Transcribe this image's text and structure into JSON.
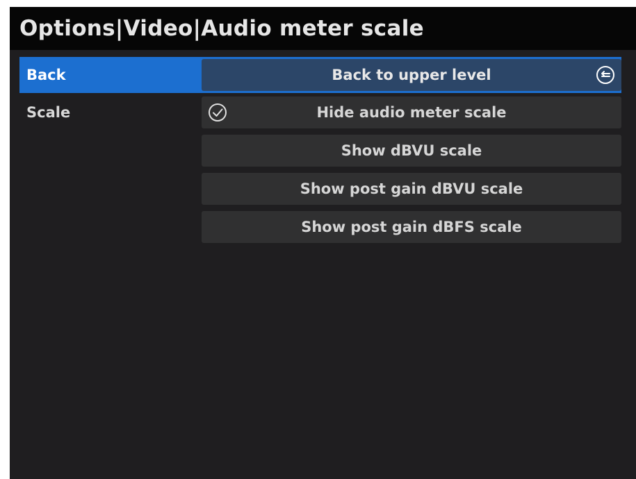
{
  "title": "Options|Video|Audio meter scale",
  "menu": {
    "back_label": "Back",
    "scale_label": "Scale",
    "back_option": "Back to upper level",
    "options": [
      {
        "label": "Hide audio meter scale",
        "checked": true
      },
      {
        "label": "Show dBVU scale",
        "checked": false
      },
      {
        "label": "Show post gain dBVU scale",
        "checked": false
      },
      {
        "label": "Show post gain dBFS scale",
        "checked": false
      }
    ]
  },
  "icons": {
    "back": "return-arrow-icon",
    "check": "checkmark-circle-icon"
  },
  "colors": {
    "background": "#1f1e20",
    "title_bar": "#060606",
    "selected_row": "#1c6fd0",
    "selected_option": "#2c4668",
    "option_button": "#303031",
    "text": "#d6d6d6"
  }
}
